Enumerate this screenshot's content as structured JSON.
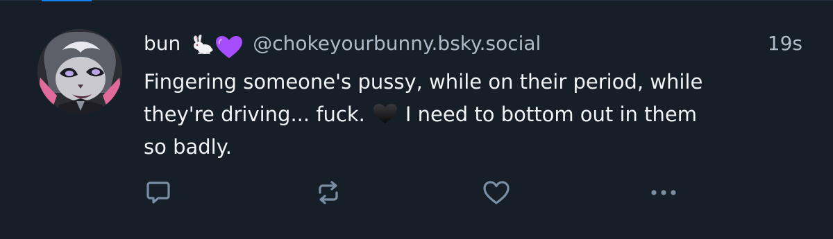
{
  "post": {
    "author": {
      "display_name": "bun",
      "name_emojis": [
        "rabbit-emoji",
        "purple-heart-emoji"
      ],
      "handle": "@chokeyourbunny.bsky.social"
    },
    "timestamp": "19s",
    "text": {
      "line1": "Fingering someone's pussy, while on their period, while",
      "line2_before_emoji": "they're driving... fuck.",
      "inline_emoji": "black-heart-emoji",
      "line2_after_emoji": "I need to bottom out in them",
      "line3": "so badly."
    },
    "actions": {
      "reply_icon": "speech-bubble-icon",
      "repost_icon": "repost-arrows-icon",
      "like_icon": "heart-outline-icon",
      "more_icon": "ellipsis-icon"
    }
  },
  "colors": {
    "background": "#161e27",
    "primary_text": "#f1f3f5",
    "secondary_text": "#aebbc9",
    "action_icon": "#7b8fa4",
    "accent": "#1083fe",
    "purple_heart": "#a64dff"
  }
}
